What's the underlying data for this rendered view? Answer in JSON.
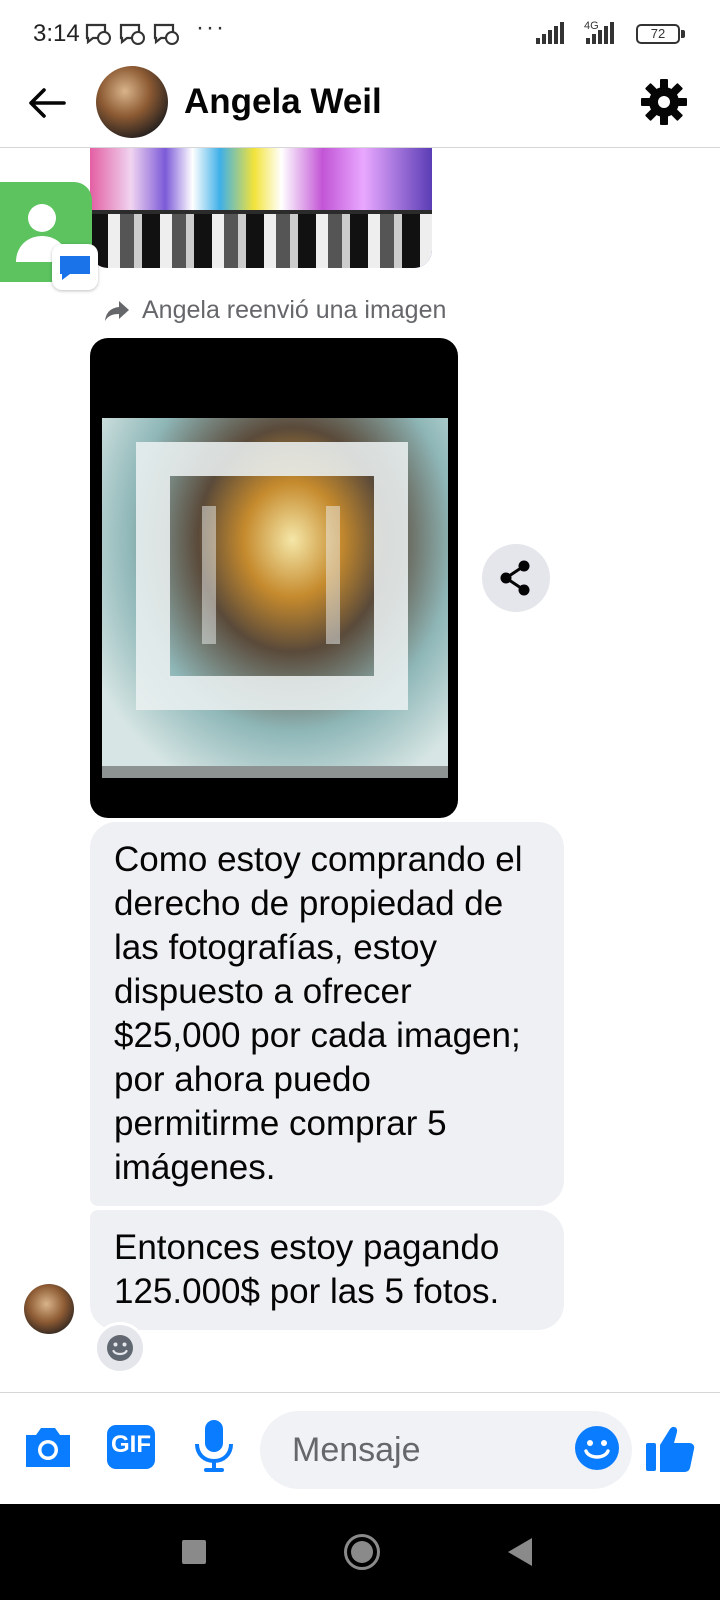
{
  "status_bar": {
    "time": "3:14",
    "more": "···",
    "network": "4G",
    "battery": "72"
  },
  "header": {
    "contact_name": "Angela Weil"
  },
  "conversation": {
    "forward_note": "Angela reenvió una imagen",
    "messages": [
      {
        "text": "Como estoy comprando el derecho de propiedad de las fotografías, estoy dispuesto a ofrecer $25,000 por cada imagen; por ahora puedo permitirme comprar 5 imágenes."
      },
      {
        "text": "Entonces estoy pagando 125.000$ por las 5 fotos."
      }
    ]
  },
  "composer": {
    "placeholder": "Mensaje",
    "gif_label": "GIF"
  },
  "colors": {
    "accent": "#0a7cff",
    "bubble_bg": "#eff0f4",
    "secondary_text": "#65676b"
  },
  "icons": [
    "back-arrow-icon",
    "gear-icon",
    "share-icon",
    "forward-icon",
    "camera-icon",
    "gif-icon",
    "microphone-icon",
    "emoji-icon",
    "thumbs-up-icon",
    "smiley-reaction-icon"
  ]
}
